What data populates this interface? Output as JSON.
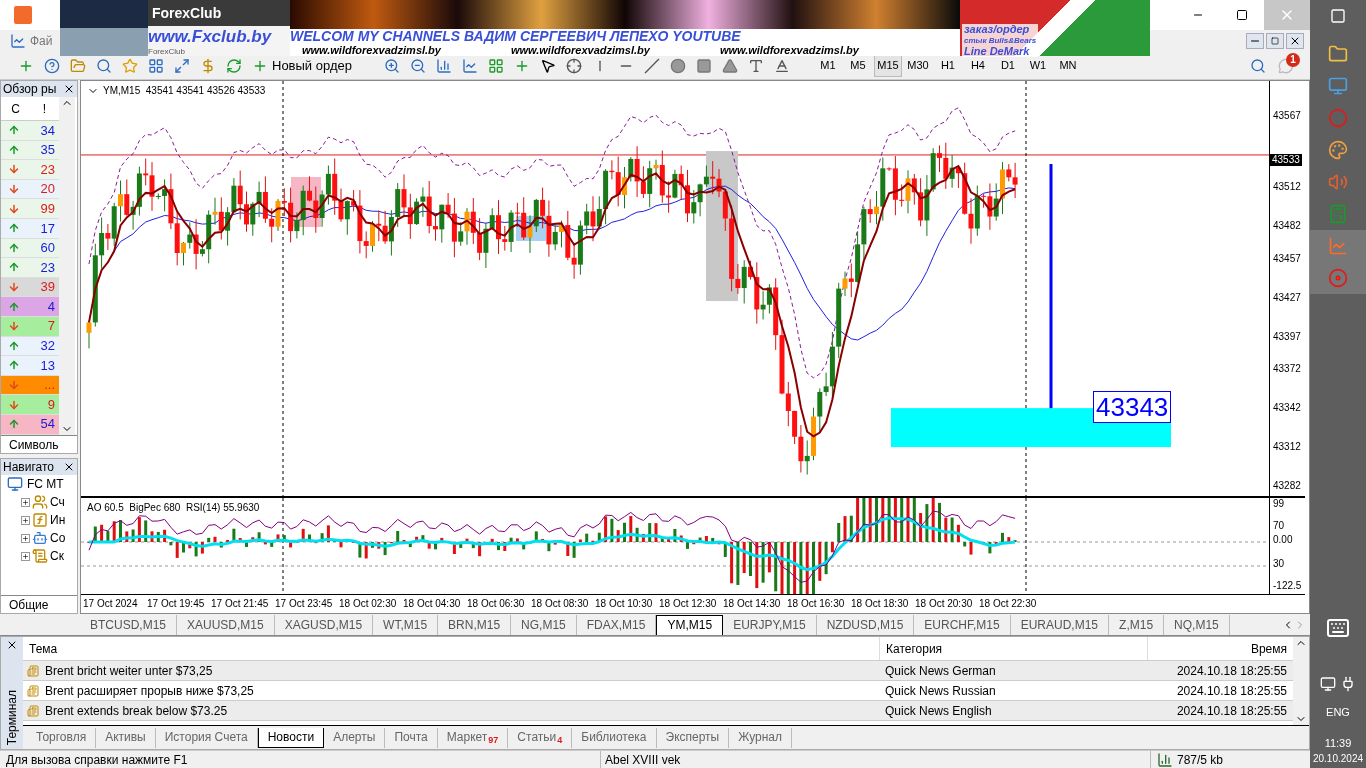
{
  "banner": {
    "photo_caption": "ForexClub",
    "logo": "ForexClub",
    "site": "www.Fxclub.by",
    "headline": "WELCOM MY CHANNELS ВАДИМ СЕРГЕЕВИЧ ЛЕПЕХО YOUTUBE",
    "links": [
      "www.wildforexvadzimsl.by",
      "www.wildforexvadzimsl.by",
      "www.wildforexvadzimsl.by"
    ],
    "legend": [
      "заказ/ордер",
      "стык Bulls&Bears",
      "Line DeMark"
    ]
  },
  "menu": {
    "first_item": "Фай"
  },
  "toolbar": {
    "new_order": "Новый ордер",
    "timeframes": [
      {
        "label": "M1",
        "selected": false
      },
      {
        "label": "M5",
        "selected": false
      },
      {
        "label": "M15",
        "selected": true
      },
      {
        "label": "M30",
        "selected": false
      },
      {
        "label": "H1",
        "selected": false
      },
      {
        "label": "H4",
        "selected": false
      },
      {
        "label": "D1",
        "selected": false
      },
      {
        "label": "W1",
        "selected": false
      },
      {
        "label": "MN",
        "selected": false
      }
    ],
    "notifications": "1"
  },
  "market_watch": {
    "title": "Обзор ры",
    "columns": [
      "С",
      "!"
    ],
    "tab": "Символь",
    "rows": [
      {
        "kind": "up",
        "value": "34",
        "color": "#eaf6ea"
      },
      {
        "kind": "up",
        "value": "35",
        "color": "#eaf6ea"
      },
      {
        "kind": "down",
        "value": "23",
        "color": "#eaf6ea"
      },
      {
        "kind": "down",
        "value": "20",
        "color": "#eaf3fb"
      },
      {
        "kind": "down",
        "value": "99",
        "color": "#eaf6ea"
      },
      {
        "kind": "up",
        "value": "17",
        "color": "#eaf3fb"
      },
      {
        "kind": "up",
        "value": "60",
        "color": "#eaf6ea"
      },
      {
        "kind": "up",
        "value": "23",
        "color": "#eaf6ea"
      },
      {
        "kind": "down",
        "value": "39",
        "color": "#d9d9d9"
      },
      {
        "kind": "up",
        "value": "4",
        "color": "#dca6e6"
      },
      {
        "kind": "down",
        "value": "7",
        "color": "#a6ee9e"
      },
      {
        "kind": "up",
        "value": "32",
        "color": "#eaf3fb"
      },
      {
        "kind": "up",
        "value": "13",
        "color": "#eaf3fb"
      },
      {
        "kind": "down",
        "value": "...",
        "color": "#ff8c00"
      },
      {
        "kind": "down",
        "value": "9",
        "color": "#a6ee9e"
      },
      {
        "kind": "up",
        "value": "54",
        "color": "#f7b6c4"
      }
    ]
  },
  "navigator": {
    "title": "Навигато",
    "root": "FC MT",
    "items": [
      {
        "kind": "accounts",
        "label": "Сч"
      },
      {
        "kind": "indicators",
        "label": "Ин"
      },
      {
        "kind": "advisors",
        "label": "Со"
      },
      {
        "kind": "scripts",
        "label": "Ск"
      }
    ],
    "tab": "Общие"
  },
  "chart": {
    "header": "YM,M15  43541 43541 43526 43533",
    "price_ticks": [
      "43567",
      "43512",
      "43482",
      "43457",
      "43427",
      "43397",
      "43372",
      "43342",
      "43312",
      "43282"
    ],
    "current_price": "43533",
    "level_label": "43343",
    "indicator_header": "AO 60.5  BigPec 680  RSI(14) 55.9630",
    "indicator_ticks": [
      "99",
      "70",
      "0.00",
      "30",
      "-122.5"
    ],
    "time_labels": [
      "17 Oct 2024",
      "17 Oct 19:45",
      "17 Oct 21:45",
      "17 Oct 23:45",
      "18 Oct 02:30",
      "18 Oct 04:30",
      "18 Oct 06:30",
      "18 Oct 08:30",
      "18 Oct 10:30",
      "18 Oct 12:30",
      "18 Oct 14:30",
      "18 Oct 16:30",
      "18 Oct 18:30",
      "18 Oct 20:30",
      "18 Oct 22:30"
    ]
  },
  "chart_tabs": [
    {
      "label": "BTCUSD,M15",
      "selected": false
    },
    {
      "label": "XAUUSD,M15",
      "selected": false
    },
    {
      "label": "XAGUSD,M15",
      "selected": false
    },
    {
      "label": "WT,M15",
      "selected": false
    },
    {
      "label": "BRN,M15",
      "selected": false
    },
    {
      "label": "NG,M15",
      "selected": false
    },
    {
      "label": "FDAX,M15",
      "selected": false
    },
    {
      "label": "YM,M15",
      "selected": true
    },
    {
      "label": "EURJPY,M15",
      "selected": false
    },
    {
      "label": "NZDUSD,M15",
      "selected": false
    },
    {
      "label": "EURCHF,M15",
      "selected": false
    },
    {
      "label": "EURAUD,M15",
      "selected": false
    },
    {
      "label": "Z,M15",
      "selected": false
    },
    {
      "label": "NQ,M15",
      "selected": false
    }
  ],
  "terminal": {
    "title": "Терминал",
    "columns": [
      "Тема",
      "Категория",
      "Время"
    ],
    "rows": [
      {
        "subject": "Brent bricht weiter unter $73,25",
        "category": "Quick News German",
        "time": "2024.10.18 18:25:55"
      },
      {
        "subject": "Brent расширяет прорыв ниже $73,25",
        "category": "Quick News Russian",
        "time": "2024.10.18 18:25:55"
      },
      {
        "subject": "Brent extends break below $73.25",
        "category": "Quick News English",
        "time": "2024.10.18 18:25:55"
      }
    ],
    "tabs": [
      {
        "label": "Торговля",
        "selected": false
      },
      {
        "label": "Активы",
        "selected": false
      },
      {
        "label": "История Счета",
        "selected": false
      },
      {
        "label": "Новости",
        "selected": true
      },
      {
        "label": "Алерты",
        "selected": false
      },
      {
        "label": "Почта",
        "selected": false
      },
      {
        "label": "Маркет",
        "badge": "97",
        "selected": false
      },
      {
        "label": "Статьи",
        "badge": "4",
        "selected": false
      },
      {
        "label": "Библиотека",
        "selected": false
      },
      {
        "label": "Эксперты",
        "selected": false
      },
      {
        "label": "Журнал",
        "selected": false
      }
    ]
  },
  "status_bar": {
    "help": "Для вызова справки нажмите F1",
    "profile": "Abel XVIII vek",
    "traffic": "787/5 kb"
  },
  "taskbar": {
    "language": "ENG",
    "time": "11:39",
    "date": "20.10.2024"
  }
}
